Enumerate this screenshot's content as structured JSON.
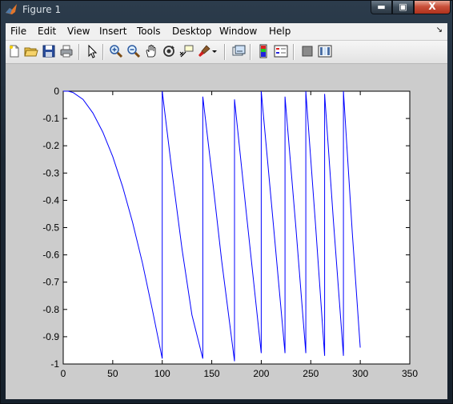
{
  "window": {
    "title": "Figure 1",
    "minimize_glyph": "▬",
    "maximize_glyph": "▣",
    "close_glyph": "X"
  },
  "menu": {
    "items": [
      "File",
      "Edit",
      "View",
      "Insert",
      "Tools",
      "Desktop",
      "Window",
      "Help"
    ],
    "dock_glyph": "↘"
  },
  "toolbar": {
    "icons": [
      "new-figure-icon",
      "open-file-icon",
      "save-icon",
      "print-icon",
      "edit-plot-arrow-icon",
      "zoom-in-icon",
      "zoom-out-icon",
      "pan-hand-icon",
      "rotate-3d-icon",
      "data-cursor-icon",
      "brush-icon",
      "brush-dropdown-icon",
      "link-plot-icon",
      "insert-colorbar-icon",
      "insert-legend-icon",
      "hide-plot-tools-icon",
      "show-plot-tools-icon"
    ]
  },
  "chart_data": {
    "type": "line",
    "title": "",
    "xlabel": "",
    "ylabel": "",
    "xlim": [
      0,
      350
    ],
    "ylim": [
      -1,
      0
    ],
    "x_ticks": [
      "0",
      "50",
      "100",
      "150",
      "200",
      "250",
      "300",
      "350"
    ],
    "y_ticks": [
      "0",
      "-0.1",
      "-0.2",
      "-0.3",
      "-0.4",
      "-0.5",
      "-0.6",
      "-0.7",
      "-0.8",
      "-0.9",
      "-1"
    ],
    "grid": false,
    "line_color": "#0000ff",
    "series": [
      {
        "x": [
          0,
          5,
          10,
          20,
          30,
          40,
          50,
          60,
          70,
          80,
          90,
          100,
          100,
          110,
          120,
          130,
          141,
          141,
          150,
          160,
          173,
          173,
          185,
          200,
          200,
          212,
          224,
          224,
          235,
          245,
          245,
          255,
          264,
          264,
          273,
          283,
          283,
          292,
          300
        ],
        "y": [
          0,
          0,
          -0.005,
          -0.03,
          -0.08,
          -0.15,
          -0.24,
          -0.35,
          -0.48,
          -0.63,
          -0.8,
          -0.98,
          0,
          -0.3,
          -0.58,
          -0.82,
          -0.98,
          -0.02,
          -0.3,
          -0.62,
          -0.99,
          -0.03,
          -0.45,
          -0.96,
          0,
          -0.48,
          -0.96,
          -0.02,
          -0.5,
          -0.96,
          0,
          -0.5,
          -0.97,
          -0.01,
          -0.48,
          -0.97,
          0,
          -0.52,
          -0.94
        ]
      }
    ]
  }
}
